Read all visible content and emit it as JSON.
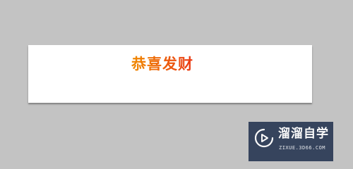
{
  "card": {
    "text": "恭喜发财"
  },
  "watermark": {
    "title": "溜溜自学",
    "url": "ZIXUE.3D66.COM",
    "icon": "play-icon"
  },
  "colors": {
    "background": "#c3c3c3",
    "card": "#ffffff",
    "text_gradient_start": "#f08a00",
    "text_gradient_end": "#ea3a17",
    "watermark_bg": "#2b3a55"
  }
}
